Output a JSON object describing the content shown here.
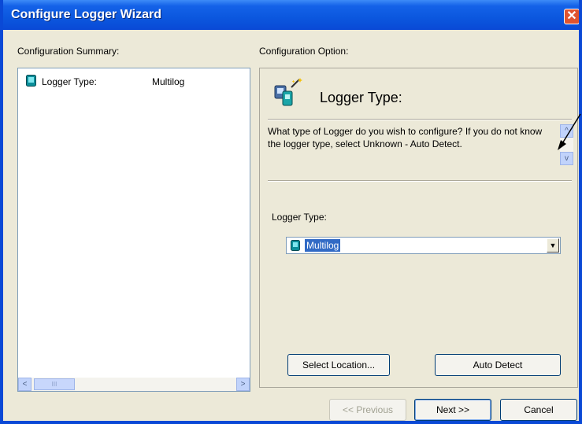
{
  "window": {
    "title": "Configure Logger Wizard",
    "close_glyph": "✕"
  },
  "labels": {
    "summary": "Configuration Summary:",
    "option": "Configuration Option:"
  },
  "summary": {
    "items": [
      {
        "label": "Logger Type:",
        "value": "Multilog",
        "icon": "logger-device-icon"
      }
    ]
  },
  "option": {
    "heading": "Logger Type:",
    "description": "What type of Logger do you wish to configure? If you do not know the logger type, select Unknown - Auto Detect.",
    "field_label": "Logger Type:",
    "selected_value": "Multilog",
    "select_location_label": "Select Location...",
    "auto_detect_label": "Auto Detect"
  },
  "buttons": {
    "previous": "<< Previous",
    "next": "Next >>",
    "cancel": "Cancel"
  },
  "scroll": {
    "left": "<",
    "right": ">",
    "up": "^",
    "down": "v",
    "grip": "III"
  },
  "colors": {
    "titlebar": "#0a49d6",
    "selection": "#316ac5",
    "window_bg": "#ece9d8"
  }
}
